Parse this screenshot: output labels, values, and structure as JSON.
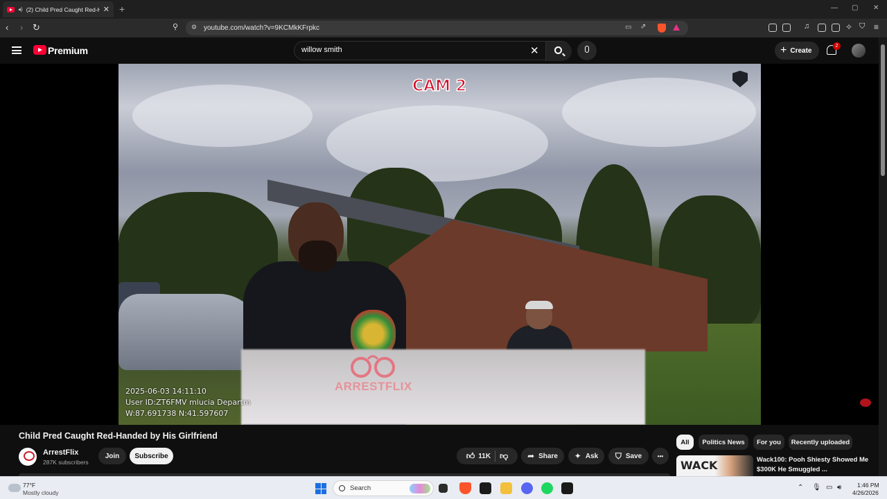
{
  "browser": {
    "tab_title": "(2) Child Pred Caught Red-Ha",
    "new_tab_symbol": "+",
    "tab_close_symbol": "✕",
    "url": "youtube.com/watch?v=9KCMkKFrpkc",
    "window_controls": [
      "—",
      "▢",
      "✕"
    ]
  },
  "youtube_header": {
    "brand": "Premium",
    "search_value": "willow smith",
    "clear_symbol": "✕",
    "create_label": "Create",
    "create_symbol": "+",
    "notification_count": "2"
  },
  "video_overlay": {
    "cam_label": "CAM 2",
    "timestamp": "2025-06-03 14:11:10",
    "user_id": "User ID:ZT6FMV mlucia Departm",
    "coords": "W:87.691738 N:41.597607",
    "watermark": "ARRESTFLIX"
  },
  "video": {
    "title": "Child Pred Caught Red-Handed by His Girlfriend",
    "channel_name": "ArrestFlix",
    "subscribers": "287K subscribers",
    "join_label": "Join",
    "subscribe_label": "Subscribe",
    "likes": "11K",
    "share_label": "Share",
    "ask_label": "Ask",
    "save_label": "Save",
    "more_symbol": "•••"
  },
  "chips": [
    "All",
    "Politics News",
    "For you",
    "Recently uploaded"
  ],
  "recommendation": {
    "thumb_text": "WACK",
    "title": "Wack100: Pooh Shiesty Showed Me $300K He Smuggled ..."
  },
  "taskbar": {
    "temperature": "77°F",
    "condition": "Mostly cloudy",
    "search_label": "Search",
    "time": "1:46 PM",
    "date": "4/26/2026"
  },
  "colors": {
    "youtube_red": "#ff0033",
    "cam_label_red": "#d4102a",
    "background": "#0f0f0f",
    "taskbar": "#e9ecf2"
  }
}
